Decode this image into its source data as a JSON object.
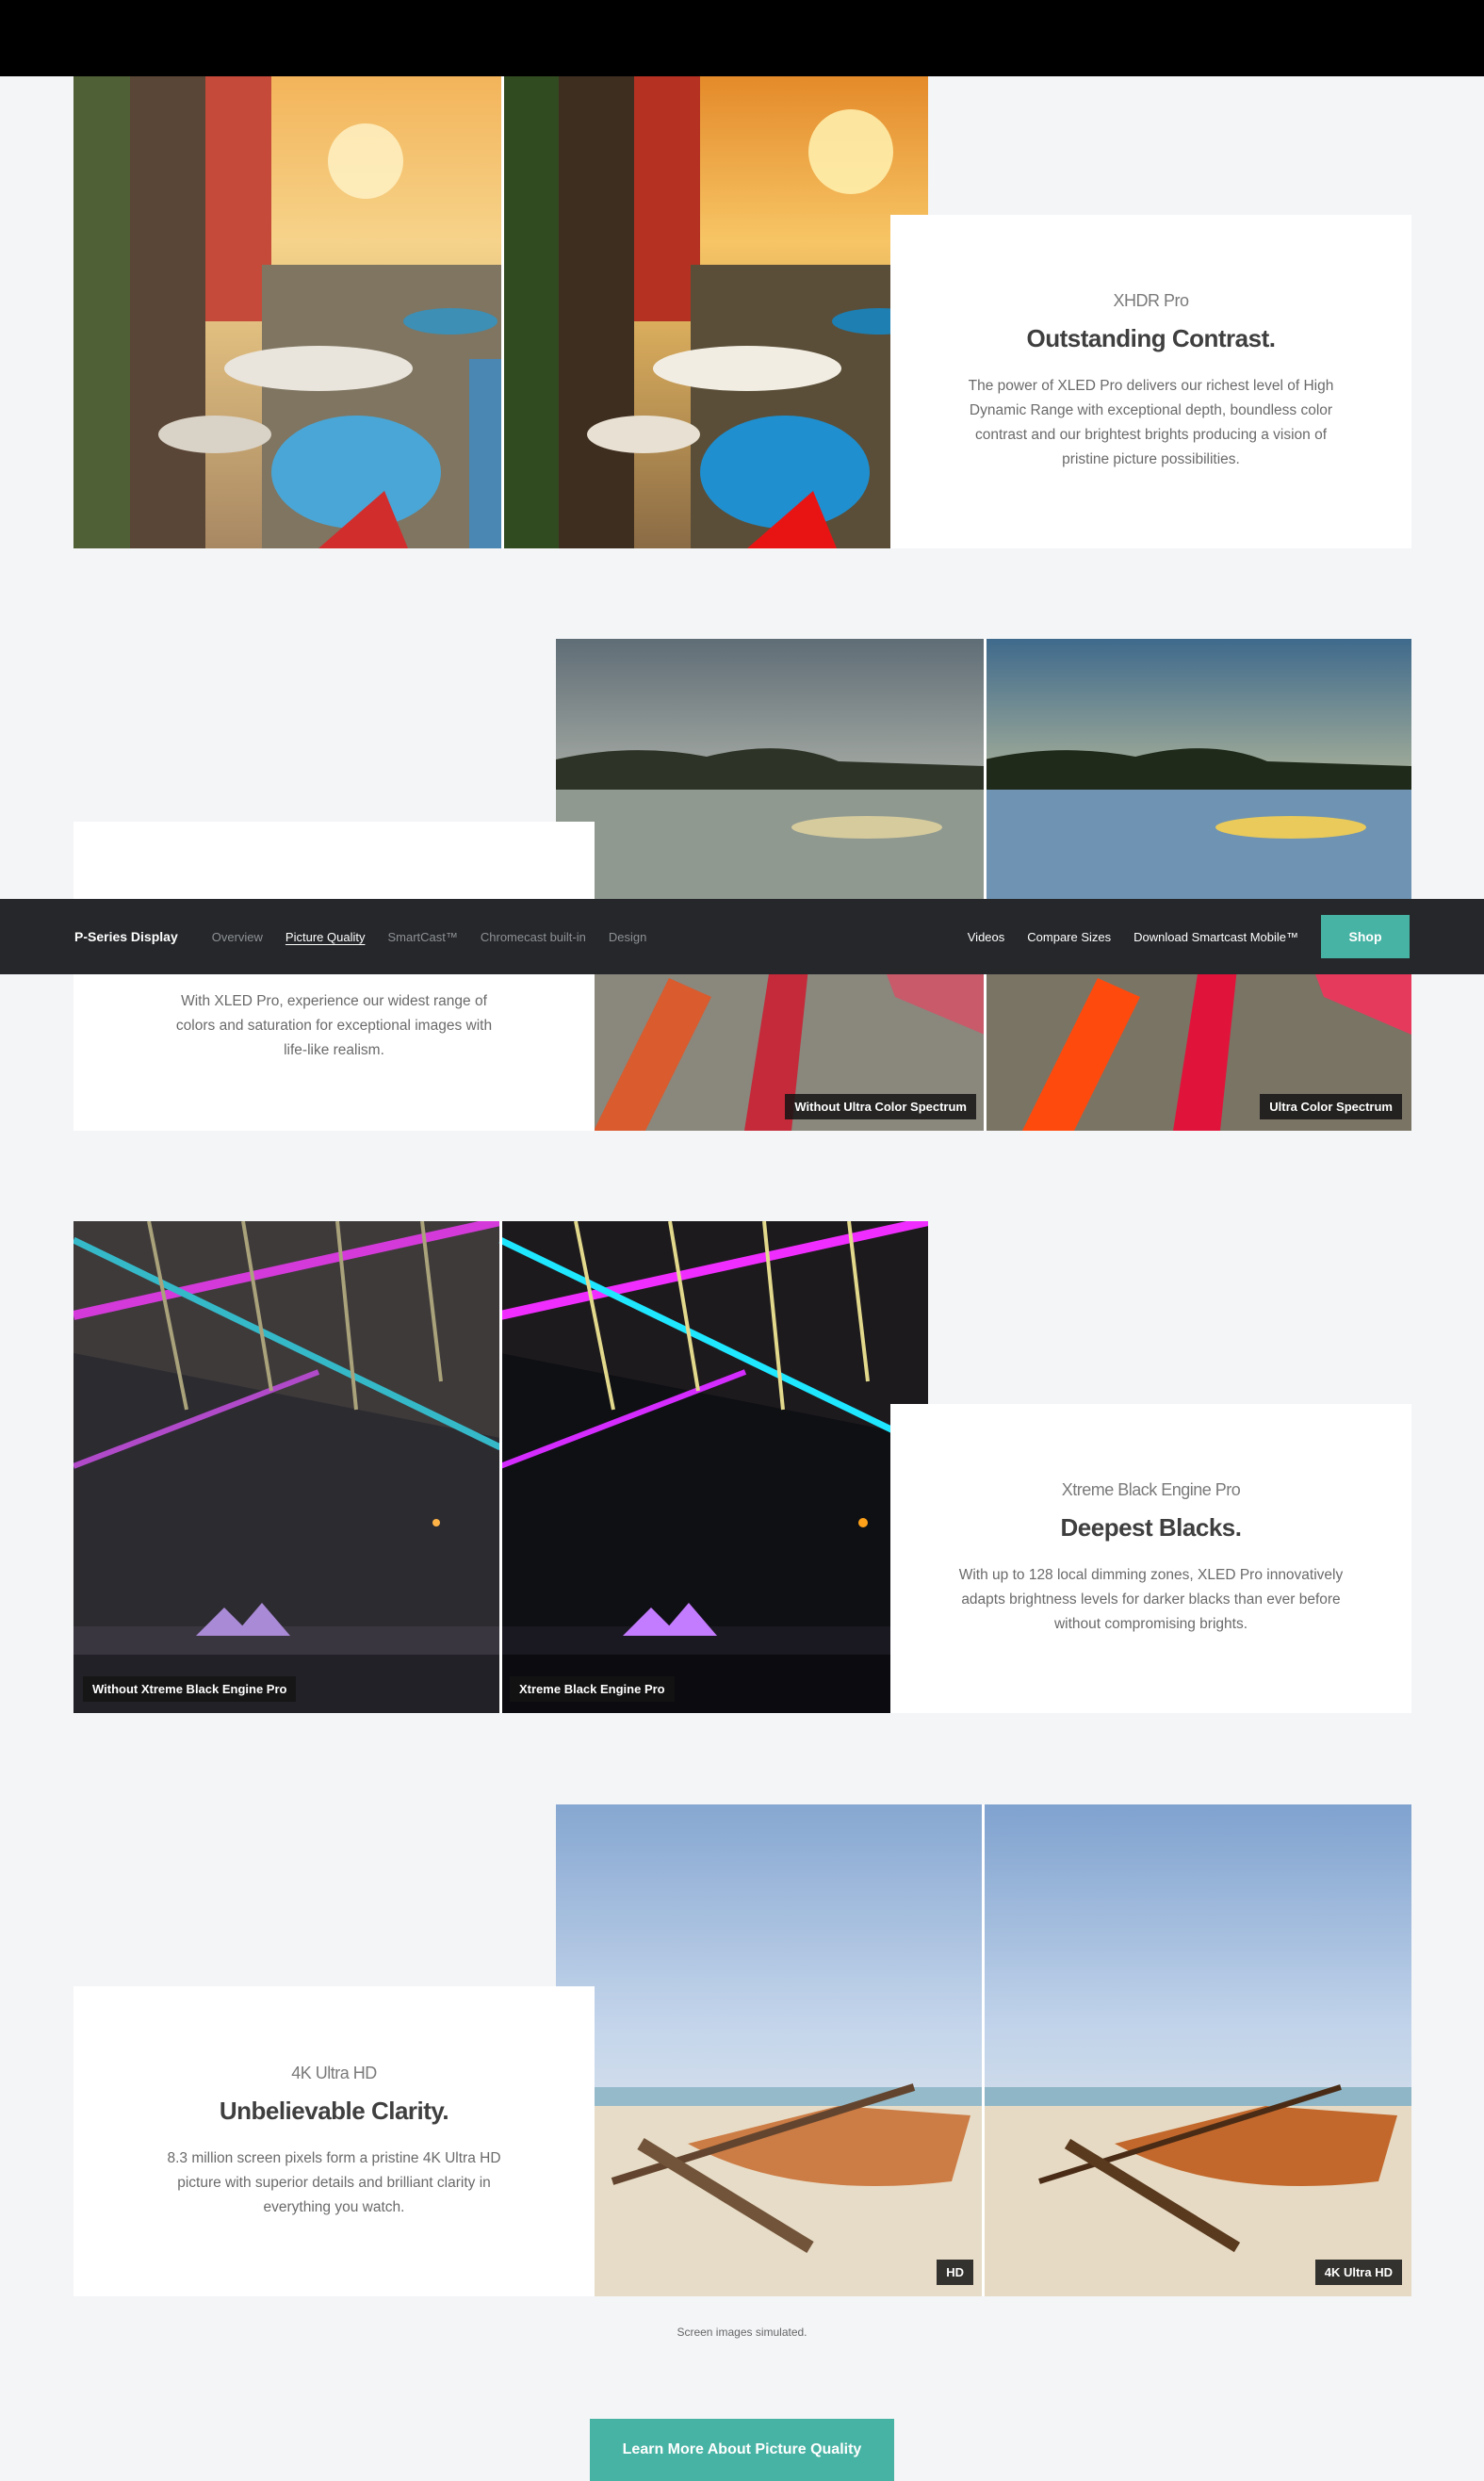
{
  "nav": {
    "brand": "P-Series Display",
    "links": [
      {
        "label": "Overview"
      },
      {
        "label": "Picture Quality"
      },
      {
        "label": "SmartCast™"
      },
      {
        "label": "Chromecast built-in"
      },
      {
        "label": "Design"
      }
    ],
    "right_links": [
      {
        "label": "Videos"
      },
      {
        "label": "Compare Sizes"
      },
      {
        "label": "Download Smartcast Mobile™"
      }
    ],
    "shop_label": "Shop",
    "accent_color": "#47b3a4"
  },
  "sections": [
    {
      "eyebrow": "XHDR Pro",
      "heading": "Outstanding Contrast.",
      "body": "The power of XLED Pro delivers our richest level of High Dynamic Range with exceptional depth, boundless color contrast and our brightest brights producing a vision of pristine picture possibilities."
    },
    {
      "body": "With XLED Pro, experience our widest range of colors and saturation for exceptional images with life-like realism.",
      "badge_left": "Without Ultra Color Spectrum",
      "badge_right": "Ultra Color Spectrum"
    },
    {
      "eyebrow": "Xtreme Black Engine Pro",
      "heading": "Deepest Blacks.",
      "body": "With up to 128 local dimming zones, XLED Pro innovatively adapts brightness levels for darker blacks than ever before without compromising brights.",
      "badge_left": "Without Xtreme Black Engine Pro",
      "badge_right": "Xtreme Black Engine Pro"
    },
    {
      "eyebrow": "4K Ultra HD",
      "heading": "Unbelievable Clarity.",
      "body": "8.3 million screen pixels form a pristine 4K Ultra HD picture with superior details and brilliant clarity in everything you watch.",
      "badge_left": "HD",
      "badge_right": "4K Ultra HD"
    }
  ],
  "footnote": "Screen images simulated.",
  "cta_label": "Learn More About Picture Quality"
}
